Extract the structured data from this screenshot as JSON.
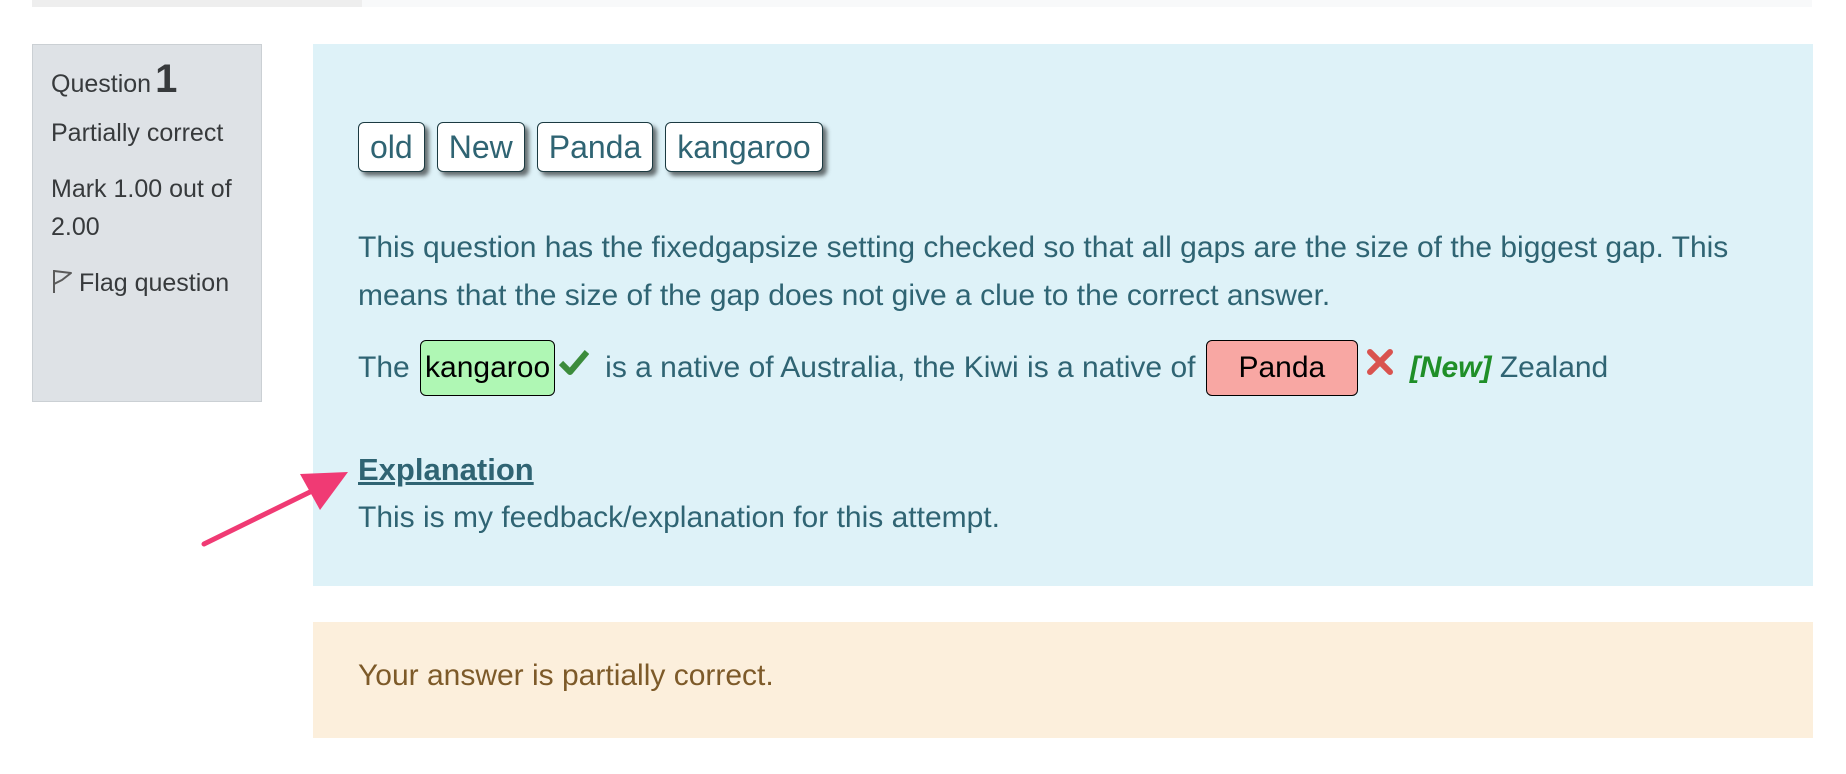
{
  "question_info": {
    "label": "Question",
    "number": "1",
    "state": "Partially correct",
    "grade": "Mark 1.00 out of 2.00",
    "flag_label": "Flag question"
  },
  "drag_items": [
    {
      "label": "old"
    },
    {
      "label": "New"
    },
    {
      "label": "Panda"
    },
    {
      "label": "kangaroo"
    }
  ],
  "question": {
    "text": "This question has the fixedgapsize setting checked so that all gaps are the size of the biggest gap. This means that the size of the gap does not give a clue to the correct answer.",
    "part_1": "The",
    "gap_1_answer": "kangaroo",
    "part_2": "is a native of Australia, the Kiwi is a native of",
    "gap_2_answer": "Panda",
    "correct_answer": "[New]",
    "part_3": "Zealand"
  },
  "explanation": {
    "heading": "Explanation",
    "text": "This is my feedback/explanation for this attempt."
  },
  "outcome": {
    "feedback": "Your answer is partially correct."
  },
  "icons": {
    "flag": "flag-icon",
    "correct": "check-icon",
    "incorrect": "cross-icon",
    "annotation": "arrow-annotation"
  },
  "colors": {
    "info_bg": "#dee2e6",
    "content_bg": "#def2f8",
    "outcome_bg": "#fcefdc",
    "correct_bg": "#aff7b4",
    "incorrect_bg": "#f8a7a3",
    "tick": "#3c8c3c",
    "cross": "#d9534f",
    "arrow": "#f03a74"
  }
}
